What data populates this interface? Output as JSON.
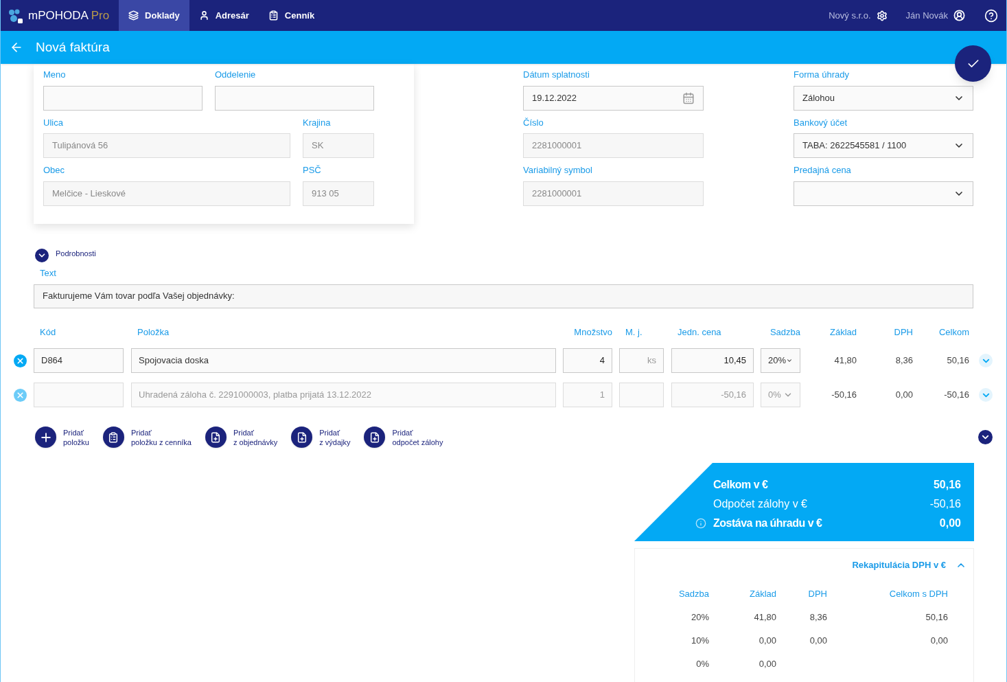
{
  "topbar": {
    "brand": "mPOHODA",
    "brand_suffix": "Pro",
    "nav": [
      {
        "label": "Doklady",
        "selected": true
      },
      {
        "label": "Adresár",
        "selected": false
      },
      {
        "label": "Cenník",
        "selected": false
      }
    ],
    "company": "Nový s.r.o.",
    "user": "Ján Novák"
  },
  "header": {
    "title": "Nová faktúra"
  },
  "address": [
    [
      {
        "label": "Meno",
        "disabled": false
      },
      {
        "label": "Oddelenie",
        "disabled": false
      }
    ],
    [
      {
        "label": "Ulica",
        "value": "Tulipánová 56",
        "disabled": true
      },
      {
        "label": "Krajina",
        "value": "SK",
        "disabled": true
      }
    ],
    [
      {
        "label": "Obec",
        "value": "Melčice - Lieskové",
        "disabled": true
      },
      {
        "label": "PSČ",
        "value": "913 05",
        "disabled": true
      }
    ]
  ],
  "document_fields": [
    [
      {
        "label": "Dátum splatnosti",
        "value": "19.12.2022",
        "kind": "date",
        "disabled": false
      },
      {
        "label": "Forma úhrady",
        "value": "Zálohou",
        "kind": "select",
        "disabled": false
      }
    ],
    [
      {
        "label": "Číslo",
        "value": "2281000001",
        "kind": "text",
        "disabled": true
      },
      {
        "label": "Bankový účet",
        "value": "TABA: 2622545581 / 1100",
        "kind": "select",
        "disabled": false
      }
    ],
    [
      {
        "label": "Variabilný symbol",
        "value": "2281000001",
        "kind": "text",
        "disabled": true
      },
      {
        "label": "Predajná cena",
        "kind": "select",
        "disabled": false
      }
    ]
  ],
  "details": {
    "label": "Podrobnosti",
    "expanded": false
  },
  "text_field": {
    "label": "Text",
    "value": "Fakturujeme Vám tovar podľa Vašej objednávky:"
  },
  "items": {
    "columns": [
      "Kód",
      "Položka",
      "Množstvo",
      "M. j.",
      "Jedn. cena",
      "Sadzba",
      "Základ",
      "DPH",
      "Celkom"
    ],
    "rows": [
      {
        "code": "D864",
        "name": "Spojovacia doska",
        "quantity": "4",
        "unit": "ks",
        "price": "10,45",
        "rate": "20%",
        "base": "41,80",
        "vat": "8,36",
        "total": "50,16",
        "disabled": false
      },
      {
        "code": "",
        "name": "Uhradená záloha č. 2291000003, platba prijatá 13.12.2022",
        "quantity": "1",
        "unit": "",
        "price": "-50,16",
        "rate": "0%",
        "base": "-50,16",
        "vat": "0,00",
        "total": "-50,16",
        "disabled": true
      }
    ]
  },
  "add_actions": [
    {
      "line1": "Pridať",
      "line2": "položku"
    },
    {
      "line1": "Pridať",
      "line2": "položku z cenníka"
    },
    {
      "line1": "Pridať",
      "line2": "z objednávky"
    },
    {
      "line1": "Pridať",
      "line2": "z výdajky"
    },
    {
      "line1": "Pridať",
      "line2": "odpočet zálohy"
    }
  ],
  "summary": [
    {
      "label": "Celkom v €",
      "value": "50,16",
      "kind": "total"
    },
    {
      "label": "Odpočet zálohy v €",
      "value": "-50,16",
      "kind": "plain"
    },
    {
      "label": "Zostáva na úhradu v €",
      "value": "0,00",
      "kind": "info"
    }
  ],
  "vat_recap": {
    "title": "Rekapitulácia DPH v €",
    "expanded": true,
    "columns": [
      "Sadzba",
      "Základ",
      "DPH",
      "Celkom s DPH"
    ],
    "rows": [
      [
        "20%",
        "41,80",
        "8,36",
        "50,16"
      ],
      [
        "10%",
        "0,00",
        "0,00",
        "0,00"
      ],
      [
        "0%",
        "0,00",
        "",
        ""
      ]
    ]
  }
}
